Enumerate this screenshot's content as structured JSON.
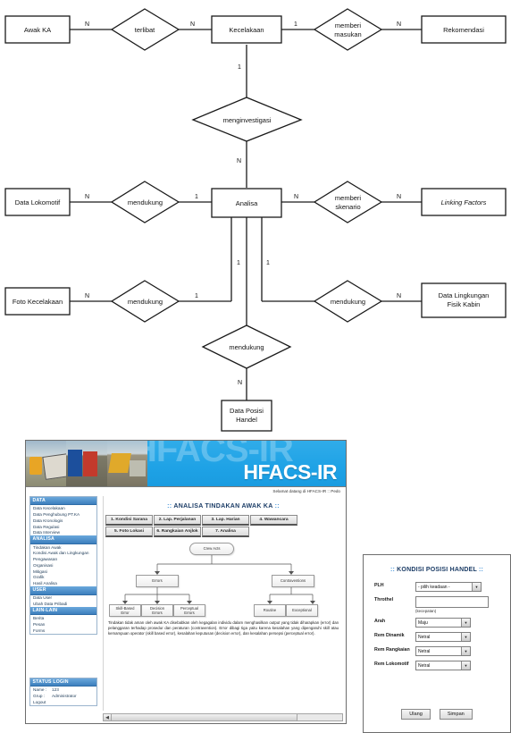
{
  "er_diagram": {
    "entities": [
      {
        "id": "awak_ka",
        "label": "Awak KA"
      },
      {
        "id": "kecelakaan",
        "label": "Kecelakaan"
      },
      {
        "id": "rekomendasi",
        "label": "Rekomendasi"
      },
      {
        "id": "data_lokomotif",
        "label": "Data Lokomotif"
      },
      {
        "id": "analisa",
        "label": "Analisa"
      },
      {
        "id": "linking_factors",
        "label": "Linking Factors",
        "italic": true
      },
      {
        "id": "foto_kecelakaan",
        "label": "Foto Kecelakaan"
      },
      {
        "id": "data_lingkungan",
        "label": "Data Lingkungan\nFisik Kabin"
      },
      {
        "id": "data_posisi_handel",
        "label": "Data Posisi\nHandel"
      }
    ],
    "relationships": [
      {
        "id": "terlibat",
        "label": "terlibat"
      },
      {
        "id": "memberi_masukan",
        "label": "memberi\nmasukan"
      },
      {
        "id": "menginvestigasi",
        "label": "menginvestigasi"
      },
      {
        "id": "mendukung_lok",
        "label": "mendukung"
      },
      {
        "id": "memberi_skenario",
        "label": "memberi\nskenario"
      },
      {
        "id": "mendukung_foto",
        "label": "mendukung"
      },
      {
        "id": "mendukung_ling",
        "label": "mendukung"
      },
      {
        "id": "mendukung_handel",
        "label": "mendukung"
      }
    ],
    "cardinalities": [
      "N",
      "N",
      "1",
      "N",
      "1",
      "N",
      "N",
      "1",
      "N",
      "N",
      "N",
      "1",
      "1",
      "1",
      "N",
      "N"
    ]
  },
  "app": {
    "brand": "HFACS-IR",
    "watermark": "HFACS-IR",
    "welcome": "Selamat datang di HFACS-IR :: Pedo",
    "page_title_prefix": "::",
    "page_title": "ANALISA TINDAKAN AWAK KA",
    "page_title_suffix": "::",
    "sidebar": {
      "sections": [
        {
          "header": "DATA",
          "items": [
            "Data Kecelakaan",
            "Data Penghubung PT.KA",
            "Data Kronologis",
            "Data Regulasi",
            "Data Interview"
          ]
        },
        {
          "header": "ANALISA",
          "items": [
            "Tindakan Awak",
            "Kondisi Awak dan Lingkungan",
            "Pengawasan",
            "Organisasi",
            "Mitigasi",
            "Grafik",
            "Hasil Analisa"
          ]
        },
        {
          "header": "USER",
          "items": [
            "Data User",
            "Ubah Data Pribadi"
          ]
        },
        {
          "header": "LAIN-LAIN",
          "items": [
            "Berita",
            "Pesan",
            "Forms"
          ]
        }
      ],
      "status": {
        "header": "STATUS LOGIN",
        "rows": [
          {
            "key": "Name :",
            "value": "123"
          },
          {
            "key": "Grup :",
            "value": "Administrator"
          }
        ],
        "logout": "Logout"
      }
    },
    "tabs": [
      "1. Kondisi Sarana",
      "2. Lap. Perjalanan",
      "3. Lap. Harian",
      "4. Wawancara",
      "5. Foto Lokasi",
      "6. Rangkaian Anjlok",
      "7. Analisa"
    ],
    "flowchart": {
      "root": "Crew Acts",
      "branch_left": "Errors",
      "branch_right": "Contraventions",
      "leaves_left": [
        "Skill-Based\nError",
        "Decision\nErrors",
        "Perceptual\nErrors"
      ],
      "leaves_right": [
        "Routine",
        "Exceptional"
      ]
    },
    "paragraph": "Tindakan tidak aman oleh awak KA disebabkan oleh kegagalan individu dalam menghasilkan output yang tidak diharapkan (error) dan pelanggaran terhadap prosedur dan peraturan (contravention). Error dibagi tiga yaitu karena kesalahan yang dipengaruhi skill atau kemampuan operator (skill based error), kesalahan keputusan (decision error), dan kesalahan persepsi (perceptual error).",
    "scroll_left_arrow": "◀"
  },
  "modal": {
    "title_prefix": "::",
    "title": "KONDISI POSISI HANDEL",
    "title_suffix": "::",
    "fields": [
      {
        "label": "PLH",
        "type": "select",
        "value": "- pilih keadaan -"
      },
      {
        "label": "Throthel",
        "type": "text",
        "value": "",
        "hint": "(kecepatan)"
      },
      {
        "label": "Arah",
        "type": "select",
        "value": "Maju"
      },
      {
        "label": "Rem Dinamik",
        "type": "select",
        "value": "Netral"
      },
      {
        "label": "Rem Rangkaian",
        "type": "select",
        "value": "Netral"
      },
      {
        "label": "Rem Lokomotif",
        "type": "select",
        "value": "Netral"
      }
    ],
    "caret": "▼",
    "reset_label": "Ulang",
    "save_label": "Simpan"
  },
  "colors": {
    "banner_blue": "#1ea2e6",
    "sidebar_header": "#3d7fbd",
    "title_blue": "#1b3c66",
    "dots_blue": "#3d90d8"
  }
}
